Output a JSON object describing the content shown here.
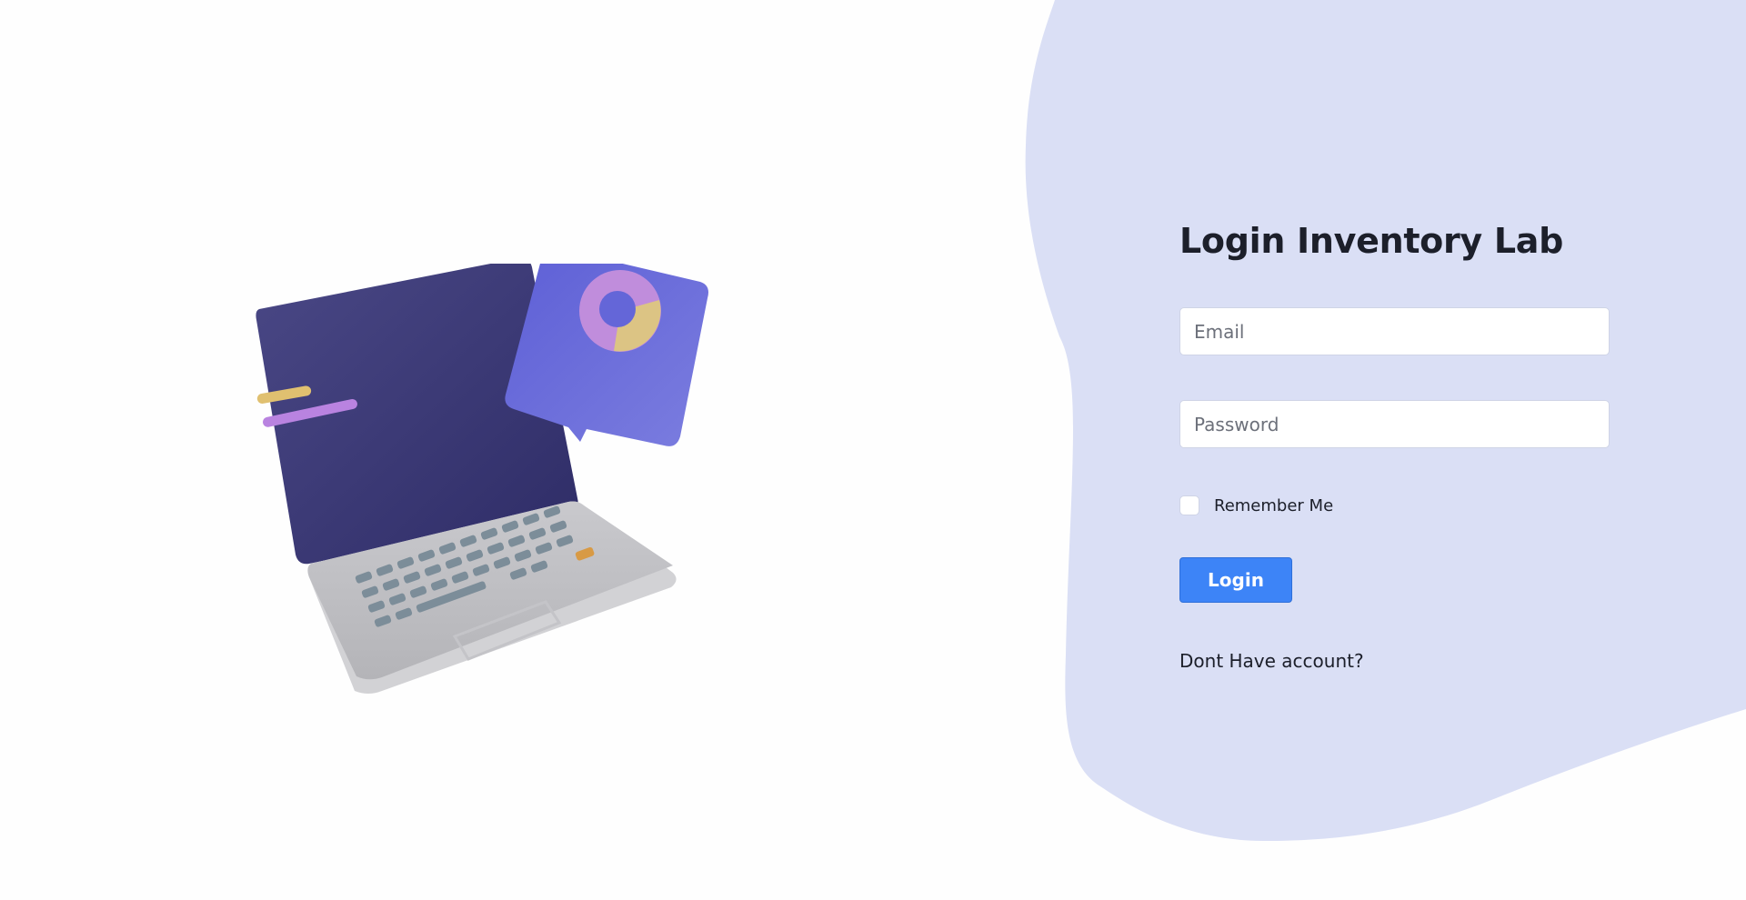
{
  "login": {
    "title": "Login Inventory Lab",
    "email_placeholder": "Email",
    "password_placeholder": "Password",
    "remember_label": "Remember Me",
    "remember_checked": false,
    "submit_label": "Login",
    "signup_link": "Dont Have account?"
  },
  "colors": {
    "background": "#fefefe",
    "blob": "#dadff5",
    "button": "#3d84f7",
    "title_text": "#1c1f2a"
  },
  "illustration": {
    "icon": "laptop-with-donut-chart-illustration"
  }
}
